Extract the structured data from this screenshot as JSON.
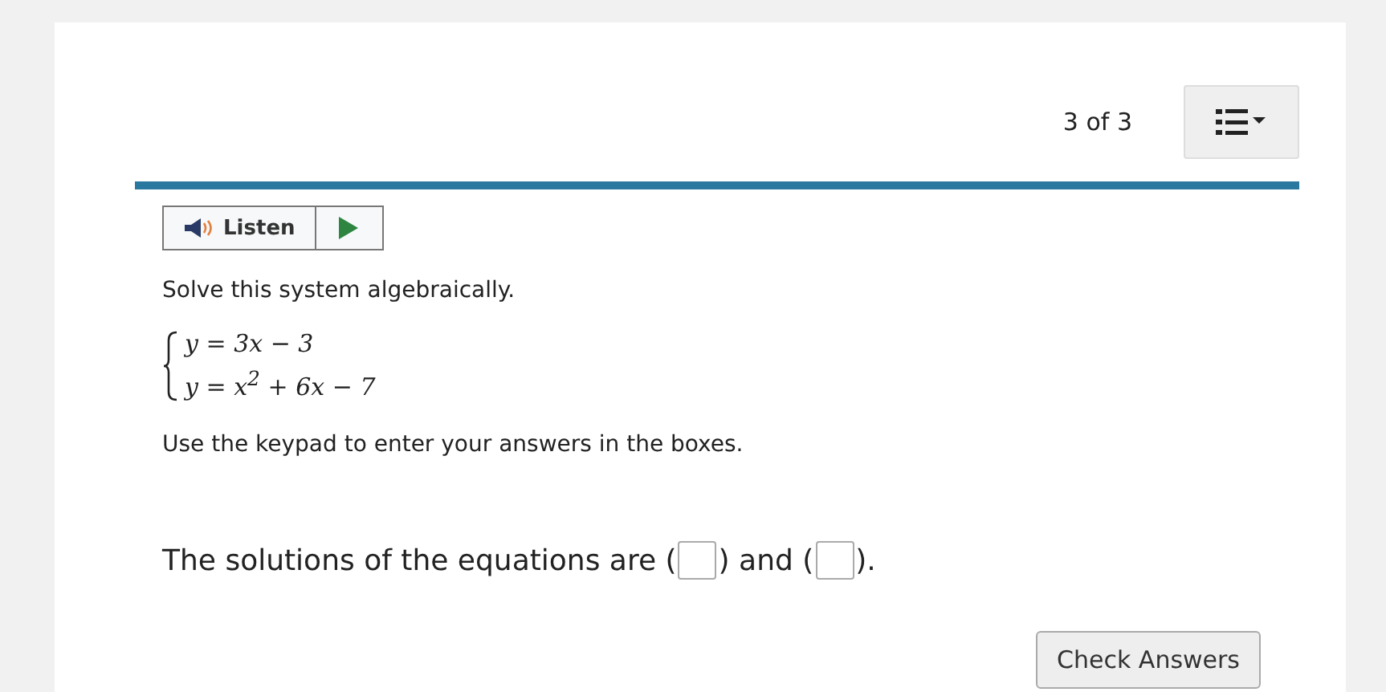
{
  "header": {
    "progress": "3 of 3"
  },
  "listen": {
    "label": "Listen"
  },
  "prompt": "Solve this system algebraically.",
  "system": [
    "y = 3x − 3",
    "y = x$^{2}$ + 6x − 7"
  ],
  "instruction": "Use the keypad to enter your answers in the boxes.",
  "answer": [
    {
      "kind": "text",
      "text": "The solutions of the equations are ("
    },
    {
      "kind": "field"
    },
    {
      "kind": "text",
      "text": ") and ("
    },
    {
      "kind": "field"
    },
    {
      "kind": "text",
      "text": ")."
    }
  ],
  "buttons": [
    "Check Answers"
  ]
}
